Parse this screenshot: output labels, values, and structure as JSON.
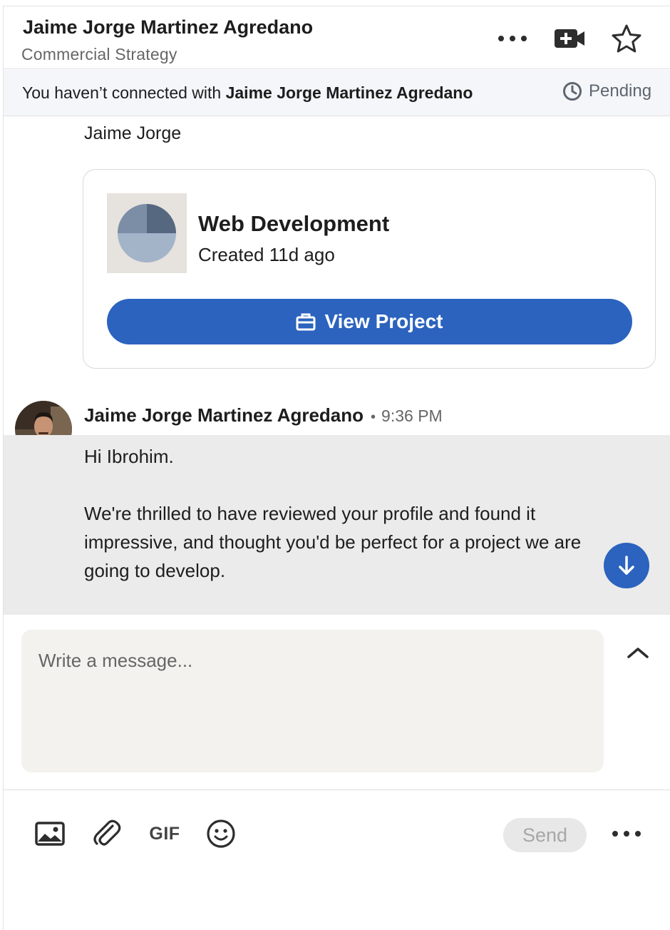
{
  "header": {
    "name": "Jaime Jorge Martinez Agredano",
    "headline": "Commercial Strategy",
    "icons": [
      "more-horizontal-icon",
      "video-add-icon",
      "star-icon"
    ]
  },
  "banner": {
    "prefix": "You haven’t connected with ",
    "name": "Jaime Jorge Martinez Agredano",
    "status": "Pending",
    "status_icon": "clock-icon"
  },
  "conversation": {
    "continued_sender": "Jaime Jorge",
    "project_card": {
      "title": "Web Development",
      "subtitle": "Created 11d ago",
      "button_label": "View Project",
      "button_icon": "briefcase-icon"
    },
    "message": {
      "sender": "Jaime Jorge Martinez Agredano",
      "separator": "•",
      "time": "9:36 PM",
      "paragraphs": [
        "Hi Ibrohim.",
        "We're thrilled to have reviewed your profile and found it impressive, and thought you'd be perfect for a project we are going to develop."
      ]
    }
  },
  "compose": {
    "placeholder": "Write a message...",
    "value": ""
  },
  "toolbar": {
    "gif_label": "GIF",
    "send_label": "Send"
  },
  "colors": {
    "accent": "#2b63be",
    "banner_bg": "#f4f6f9",
    "message_bg": "#ebebeb",
    "compose_bg": "#f3f2ef"
  }
}
